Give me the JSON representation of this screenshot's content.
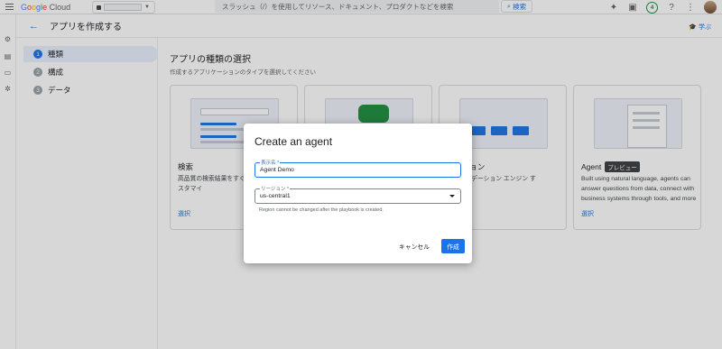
{
  "topbar": {
    "logo": "Google Cloud",
    "search_placeholder": "スラッシュ（/）を使用してリソース、ドキュメント、プロダクトなどを検索",
    "search_button": "検索",
    "notification_count": "4"
  },
  "header": {
    "title": "アプリを作成する",
    "learn": "学ぶ"
  },
  "stepper": {
    "steps": [
      {
        "num": "1",
        "label": "種類"
      },
      {
        "num": "2",
        "label": "構成"
      },
      {
        "num": "3",
        "label": "データ"
      }
    ]
  },
  "main": {
    "title": "アプリの種類の選択",
    "subtitle": "作成するアプリケーションのタイプを選択してください",
    "cards": [
      {
        "title": "検索",
        "desc": "高品質の検索結果をすぐ ジンも簡単にカスタマイ",
        "select": "選択"
      },
      {
        "title": "",
        "desc": "",
        "select": ""
      },
      {
        "title": "デーション",
        "desc": "レコメンデーション エンジン す",
        "select": ""
      },
      {
        "title": "Agent",
        "badge": "プレビュー",
        "desc": "Built using natural language, agents can answer questions from data, connect with business systems through tools, and more",
        "select": "選択"
      }
    ]
  },
  "dialog": {
    "title": "Create an agent",
    "name_label": "表示名 *",
    "name_value": "Agent Demo",
    "region_label": "リージョン *",
    "region_value": "us-central1",
    "region_hint": "Region cannot be changed after the playbook is created.",
    "cancel": "キャンセル",
    "create": "作成"
  }
}
